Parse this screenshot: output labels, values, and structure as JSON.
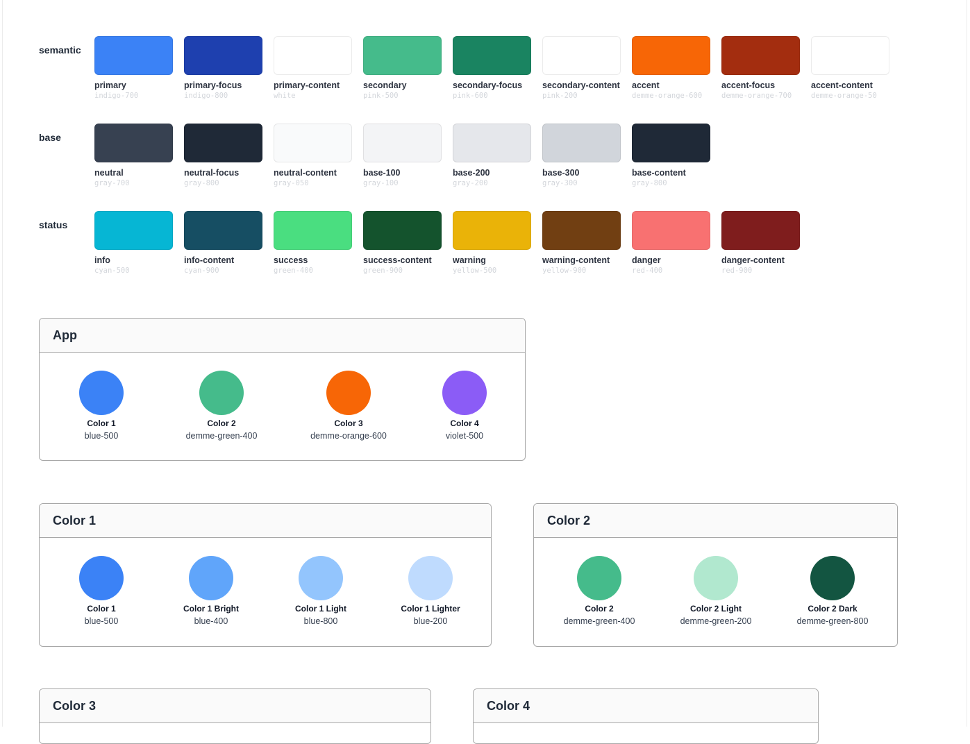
{
  "palette": {
    "semantic": {
      "label": "semantic",
      "items": [
        {
          "name": "primary",
          "token": "indigo-700",
          "color": "#3b82f6"
        },
        {
          "name": "primary-focus",
          "token": "indigo-800",
          "color": "#1e40af"
        },
        {
          "name": "primary-content",
          "token": "white",
          "color": "#ffffff"
        },
        {
          "name": "secondary",
          "token": "pink-500",
          "color": "#45bb8b"
        },
        {
          "name": "secondary-focus",
          "token": "pink-600",
          "color": "#1a8461"
        },
        {
          "name": "secondary-content",
          "token": "pink-200",
          "color": "#ffffff"
        },
        {
          "name": "accent",
          "token": "demme-orange-600",
          "color": "#f76606"
        },
        {
          "name": "accent-focus",
          "token": "demme-orange-700",
          "color": "#a32d0f"
        },
        {
          "name": "accent-content",
          "token": "demme-orange-50",
          "color": "#ffffff"
        }
      ]
    },
    "base": {
      "label": "base",
      "items": [
        {
          "name": "neutral",
          "token": "gray-700",
          "color": "#374151"
        },
        {
          "name": "neutral-focus",
          "token": "gray-800",
          "color": "#1f2937"
        },
        {
          "name": "neutral-content",
          "token": "gray-050",
          "color": "#f9fafb"
        },
        {
          "name": "base-100",
          "token": "gray-100",
          "color": "#f3f4f6"
        },
        {
          "name": "base-200",
          "token": "gray-200",
          "color": "#e5e7eb"
        },
        {
          "name": "base-300",
          "token": "gray-300",
          "color": "#d1d5db"
        },
        {
          "name": "base-content",
          "token": "gray-800",
          "color": "#1f2937"
        }
      ]
    },
    "status": {
      "label": "status",
      "items": [
        {
          "name": "info",
          "token": "cyan-500",
          "color": "#06b6d4"
        },
        {
          "name": "info-content",
          "token": "cyan-900",
          "color": "#164e63"
        },
        {
          "name": "success",
          "token": "green-400",
          "color": "#4ade80"
        },
        {
          "name": "success-content",
          "token": "green-900",
          "color": "#14532d"
        },
        {
          "name": "warning",
          "token": "yellow-500",
          "color": "#eab308"
        },
        {
          "name": "warning-content",
          "token": "yellow-900",
          "color": "#713f12"
        },
        {
          "name": "danger",
          "token": "red-400",
          "color": "#f87171"
        },
        {
          "name": "danger-content",
          "token": "red-900",
          "color": "#7f1d1d"
        }
      ]
    }
  },
  "cards": {
    "app": {
      "title": "App",
      "swatches": [
        {
          "name": "Color 1",
          "token": "blue-500",
          "color": "#3b82f6"
        },
        {
          "name": "Color 2",
          "token": "demme-green-400",
          "color": "#45bb8b"
        },
        {
          "name": "Color 3",
          "token": "demme-orange-600",
          "color": "#f76606"
        },
        {
          "name": "Color 4",
          "token": "violet-500",
          "color": "#8b5cf6"
        }
      ]
    },
    "color1": {
      "title": "Color 1",
      "swatches": [
        {
          "name": "Color 1",
          "token": "blue-500",
          "color": "#3b82f6"
        },
        {
          "name": "Color 1 Bright",
          "token": "blue-400",
          "color": "#60a5fa"
        },
        {
          "name": "Color 1 Light",
          "token": "blue-800",
          "color": "#93c5fd"
        },
        {
          "name": "Color 1 Lighter",
          "token": "blue-200",
          "color": "#bfdbfe"
        }
      ]
    },
    "color2": {
      "title": "Color 2",
      "swatches": [
        {
          "name": "Color 2",
          "token": "demme-green-400",
          "color": "#45bb8b"
        },
        {
          "name": "Color 2 Light",
          "token": "demme-green-200",
          "color": "#b1e8cf"
        },
        {
          "name": "Color 2 Dark",
          "token": "demme-green-800",
          "color": "#135541"
        }
      ]
    },
    "color3": {
      "title": "Color 3"
    },
    "color4": {
      "title": "Color 4"
    }
  }
}
